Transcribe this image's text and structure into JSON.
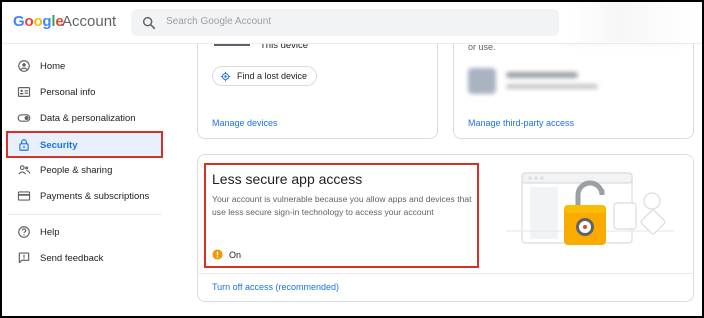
{
  "header": {
    "logo": [
      "G",
      "o",
      "o",
      "g",
      "l",
      "e"
    ],
    "app_name": "Account",
    "search_placeholder": "Search Google Account"
  },
  "sidebar": {
    "items": [
      {
        "label": "Home",
        "icon": "home-icon"
      },
      {
        "label": "Personal info",
        "icon": "id-card-icon"
      },
      {
        "label": "Data & personalization",
        "icon": "toggle-icon"
      },
      {
        "label": "Security",
        "icon": "lock-icon",
        "active": true
      },
      {
        "label": "People & sharing",
        "icon": "people-icon"
      },
      {
        "label": "Payments & subscriptions",
        "icon": "credit-card-icon"
      },
      {
        "label": "Help",
        "icon": "help-icon"
      },
      {
        "label": "Send feedback",
        "icon": "feedback-icon"
      }
    ]
  },
  "devices_card": {
    "this_device": "This device",
    "find_device": "Find a lost device",
    "manage_link": "Manage devices"
  },
  "third_party_card": {
    "or_use": "or use.",
    "manage_link": "Manage third-party access"
  },
  "less_secure_card": {
    "title": "Less secure app access",
    "description": "Your account is vulnerable because you allow apps and devices that use less secure sign-in technology to access your account",
    "status": "On",
    "action_link": "Turn off access (recommended)"
  },
  "colors": {
    "accent": "#1a73e8",
    "highlight": "#d93025",
    "warning": "#f29900"
  }
}
